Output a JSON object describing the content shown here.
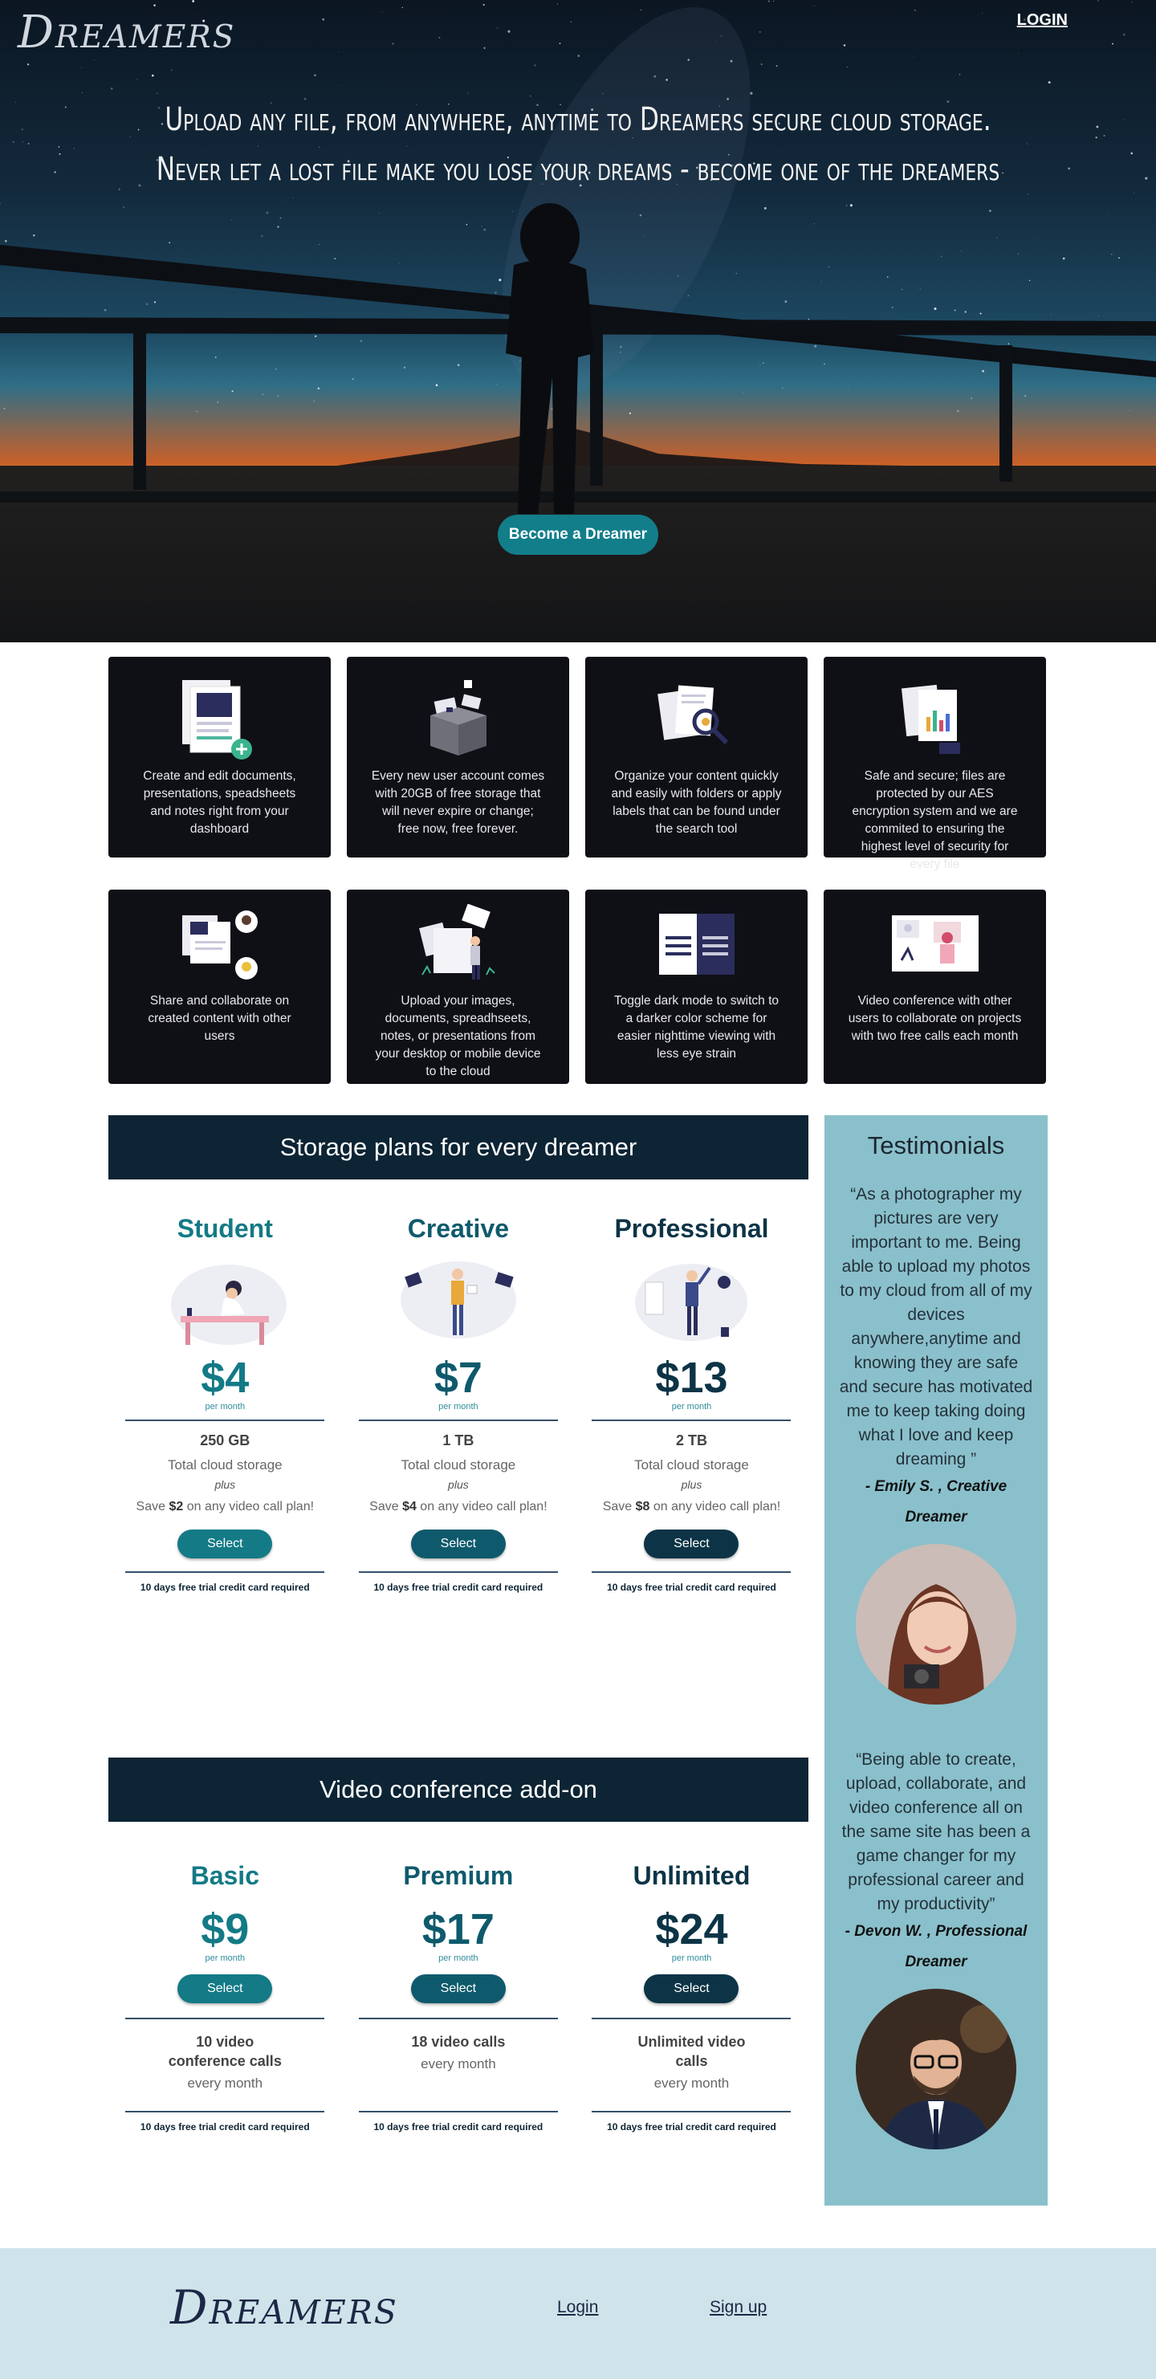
{
  "brand": {
    "name": "Dreamers"
  },
  "nav": {
    "login": "LOGIN"
  },
  "hero": {
    "line1": "Upload any file, from anywhere, anytime to Dreamers secure cloud storage.",
    "line2": "Never let a lost file make you lose your dreams - become one of the dreamers",
    "cta": "Become a Dreamer"
  },
  "features": [
    {
      "text": "Create and edit documents, presentations, speadsheets and  notes right from your dashboard",
      "icon": "documents-add-icon"
    },
    {
      "text": "Every new user account comes with 20GB of free storage that will never expire or change; free now, free forever.",
      "icon": "open-box-icon"
    },
    {
      "text": "Organize your content quickly and easily with folders or apply labels that can be found under the search tool",
      "icon": "search-documents-icon"
    },
    {
      "text": "Safe and secure; files are protected by our AES encryption system and we are commited to ensuring the highest level of security for every file",
      "icon": "secure-chart-icon"
    },
    {
      "text": "Share and collaborate on created content with other users",
      "icon": "share-users-icon"
    },
    {
      "text": "Upload your images, documents, spreadhseets, notes, or presentations from your desktop or mobile device to the cloud",
      "icon": "upload-person-icon"
    },
    {
      "text": "Toggle dark mode to switch to a darker color scheme for easier nighttime viewing with less eye strain",
      "icon": "dark-mode-icon"
    },
    {
      "text": "Video conference with other users to collaborate on projects with two free calls each month",
      "icon": "video-conference-icon"
    }
  ],
  "storage": {
    "heading": "Storage plans for every dreamer",
    "plans": [
      {
        "name": "Student",
        "price": "$4",
        "per": "per month",
        "amount": "250 GB",
        "desc": "Total cloud storage",
        "plus": "plus",
        "save_pre": "Save ",
        "save_amt": "$2",
        "save_post": " on any video call plan!",
        "select": "Select",
        "trial": "10 days free trial credit card required",
        "color": "#137a86"
      },
      {
        "name": "Creative",
        "price": "$7",
        "per": "per month",
        "amount": "1 TB",
        "desc": "Total cloud storage",
        "plus": "plus",
        "save_pre": "Save ",
        "save_amt": "$4",
        "save_post": " on any video call plan!",
        "select": "Select",
        "trial": "10 days free trial credit card required",
        "color": "#0e5a6c"
      },
      {
        "name": "Professional",
        "price": "$13",
        "per": "per month",
        "amount": "2 TB",
        "desc": "Total cloud storage",
        "plus": "plus",
        "save_pre": "Save ",
        "save_amt": "$8",
        "save_post": " on any video call plan!",
        "select": "Select",
        "trial": "10 days free trial credit card required",
        "color": "#0c3446"
      }
    ]
  },
  "video": {
    "heading": "Video conference add-on",
    "plans": [
      {
        "name": "Basic",
        "price": "$9",
        "per": "per month",
        "select": "Select",
        "calls": "10 video conference calls",
        "period": "every month",
        "trial": "10 days free trial credit card required",
        "color": "#137a86"
      },
      {
        "name": "Premium",
        "price": "$17",
        "per": "per month",
        "select": "Select",
        "calls": "18 video calls",
        "period": "every month",
        "trial": "10 days free trial credit card required",
        "color": "#0e5a6c"
      },
      {
        "name": "Unlimited",
        "price": "$24",
        "per": "per month",
        "select": "Select",
        "calls": "Unlimited video calls",
        "period": "every month",
        "trial": "10 days free trial credit card required",
        "color": "#0c3446"
      }
    ]
  },
  "testimonials": {
    "heading": "Testimonials",
    "items": [
      {
        "quote": "“As a photographer my pictures are very important to me. Being able to upload my photos to my cloud from all of my devices anywhere,anytime and knowing they are safe and secure has motivated me to keep taking doing what I love and keep dreaming ”",
        "author": "- Emily S. , Creative Dreamer"
      },
      {
        "quote": "“Being able to create, upload, collaborate, and video conference all on the same site has been a game changer for my professional career and my productivity”",
        "author": "- Devon W. , Professional Dreamer"
      }
    ]
  },
  "footer": {
    "login": "Login",
    "signup": "Sign up"
  }
}
